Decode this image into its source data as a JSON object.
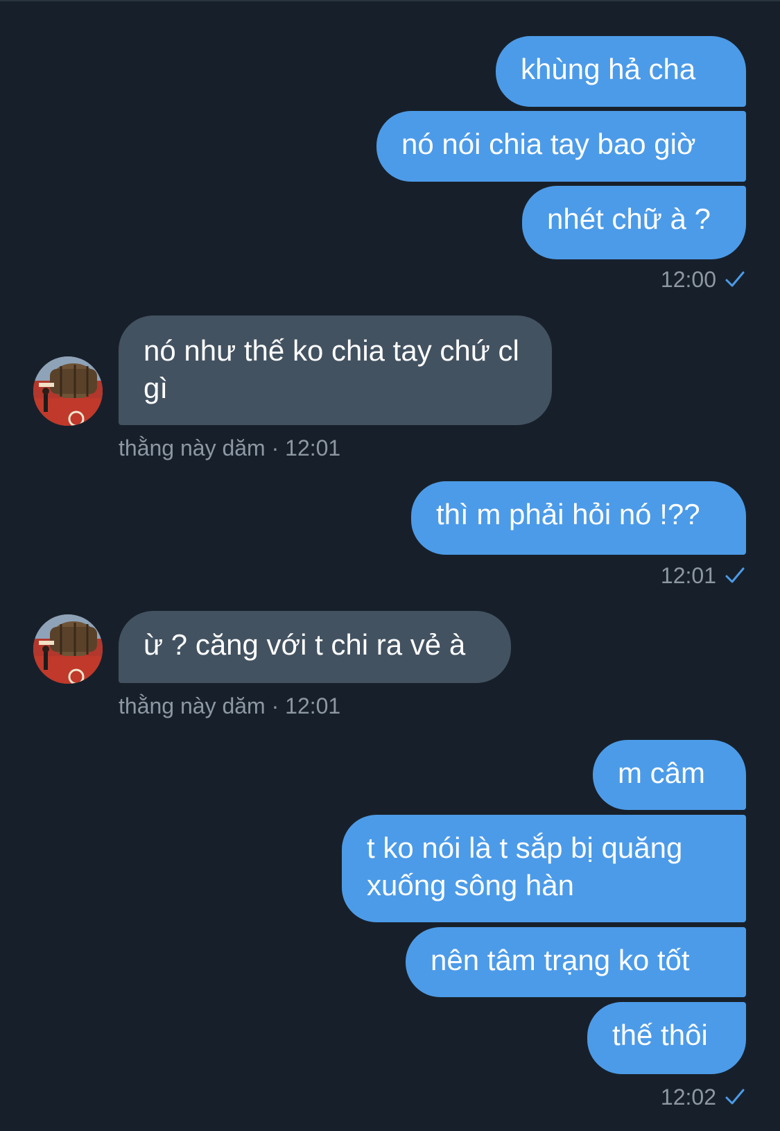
{
  "conversation": {
    "groups": [
      {
        "direction": "outgoing",
        "messages": [
          "khùng hả cha",
          "nó nói chia tay bao giờ",
          "nhét chữ à ?"
        ],
        "time": "12:00",
        "status_icon": "check-icon"
      },
      {
        "direction": "incoming",
        "sender": "thằng này dăm",
        "messages": [
          "nó như thế ko chia tay chứ cl gì"
        ],
        "meta": "thằng này dăm · 12:01",
        "avatar_icon": "avatar-barrel-photo"
      },
      {
        "direction": "outgoing",
        "messages": [
          "thì m phải hỏi nó !??"
        ],
        "time": "12:01",
        "status_icon": "check-icon"
      },
      {
        "direction": "incoming",
        "sender": "thằng này dăm",
        "messages": [
          "ừ ? căng với t chi ra vẻ à"
        ],
        "meta": "thằng này dăm · 12:01",
        "avatar_icon": "avatar-barrel-photo"
      },
      {
        "direction": "outgoing",
        "messages": [
          "m câm",
          "t ko nói là t sắp bị quăng xuống sông hàn",
          "nên tâm trạng ko tốt",
          "thế thôi"
        ],
        "time": "12:02",
        "status_icon": "check-icon"
      }
    ]
  },
  "colors": {
    "background": "#17202a",
    "outgoing_bubble": "#4c9be8",
    "incoming_bubble": "#435261",
    "meta_text": "#8d98a4",
    "check": "#4c9be8"
  }
}
